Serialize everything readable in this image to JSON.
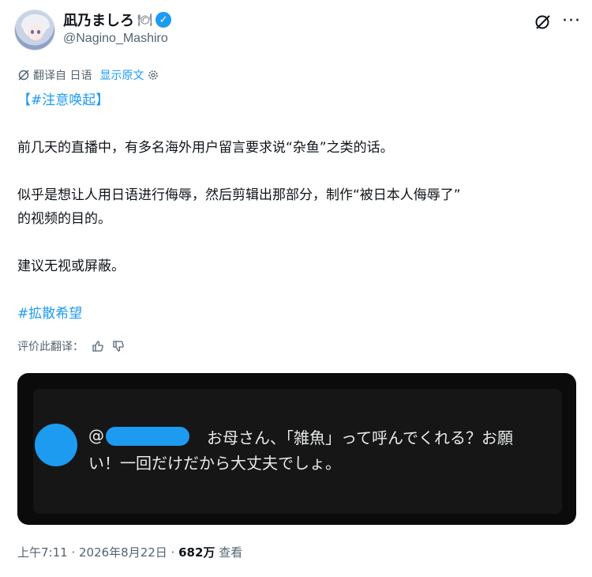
{
  "author": {
    "display_name": "凪乃ましろ",
    "name_emoji": "🍽",
    "handle": "@Nagino_Mashiro",
    "verified_icon": "verified-badge-icon",
    "accent": "#1d9bf0"
  },
  "header_actions": {
    "grok_icon": "grok-icon",
    "more_icon": "more-options-icon",
    "more_glyph": "···"
  },
  "translation": {
    "label": "翻译自 日语",
    "show_original": "显示原文",
    "settings_icon": "gear-icon"
  },
  "post": {
    "tag_open": "【",
    "tag_text": "#注意唤起",
    "tag_close": "】",
    "line1": "前几天的直播中，有多名海外用户留言要求说“杂鱼”之类的话。",
    "line2": "似乎是想让人用日语进行侮辱，然后剪辑出那部分，制作“被日本人侮辱了”",
    "line3": "的视频的目的。",
    "line4": "建议无视或屏蔽。",
    "hashtag2": "#拡散希望"
  },
  "rate": {
    "label": "评价此翻译：",
    "thumbs_up_icon": "thumbs-up-icon",
    "thumbs_down_icon": "thumbs-down-icon"
  },
  "media": {
    "at": "@",
    "comment_line1": "お母さん、「雑魚」って呼んでくれる？お願",
    "comment_line2": "い！一回だけだから大丈夫でしょ。"
  },
  "meta": {
    "time_date": "上午7:11 · 2026年8月22日 · ",
    "views_count": "682万",
    "views_label": " 查看"
  }
}
